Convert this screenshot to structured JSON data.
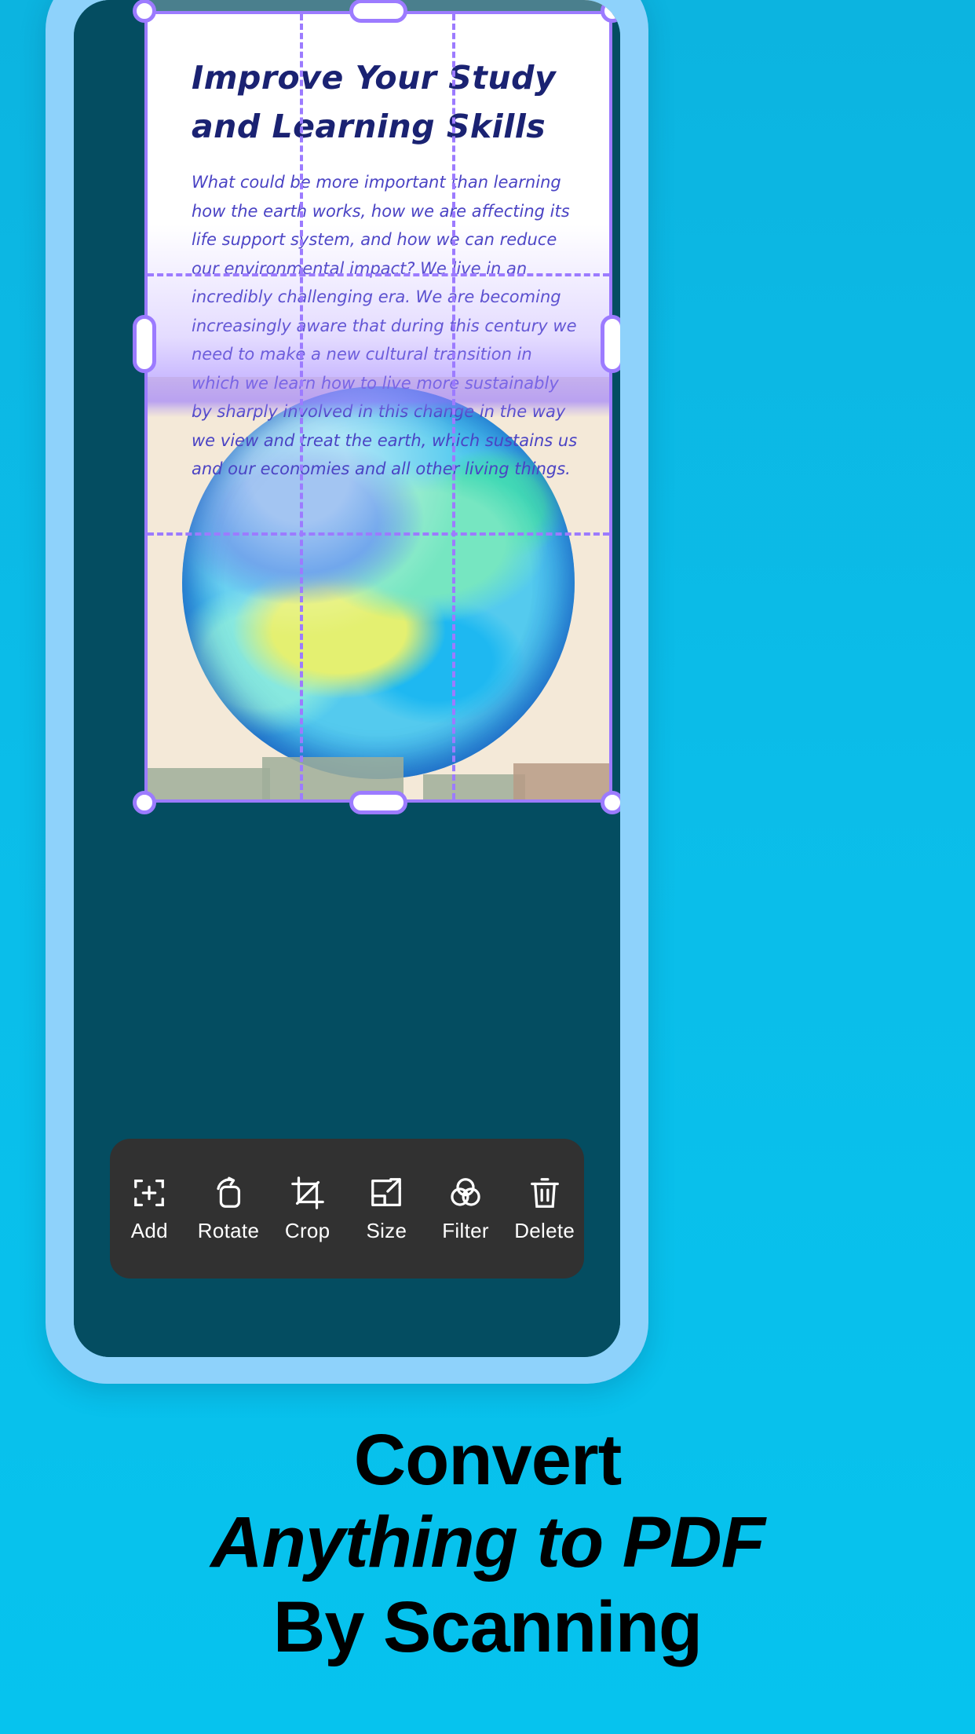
{
  "document": {
    "title": "Improve Your Study and Learning Skills",
    "body": "What could be more important than learning how the earth works, how we are affecting its life support system, and how we can reduce our environmental impact? We live in an incredibly challenging era. We are becoming increasingly aware that during this century we need to make a new cultural transition in which we learn how to live more sustainably by sharply involved in this change in the way we view and treat the earth, which sustains us and our economies and all other living things."
  },
  "toolbar": {
    "items": [
      {
        "label": "Add",
        "icon": "add-frame-icon"
      },
      {
        "label": "Rotate",
        "icon": "rotate-icon"
      },
      {
        "label": "Crop",
        "icon": "crop-icon"
      },
      {
        "label": "Size",
        "icon": "resize-icon"
      },
      {
        "label": "Filter",
        "icon": "filter-circles-icon"
      },
      {
        "label": "Delete",
        "icon": "trash-icon"
      }
    ]
  },
  "headline": {
    "line1": "Convert",
    "line2": "Anything to PDF",
    "line3": "By Scanning"
  },
  "colors": {
    "background": "#0bbde9",
    "phone_bezel": "#8ed2fb",
    "phone_screen": "#044e61",
    "crop_accent": "#9c7bff",
    "toolbar_bg": "#313131",
    "title_ink": "#1a2272",
    "body_ink": "#4a43c4"
  }
}
